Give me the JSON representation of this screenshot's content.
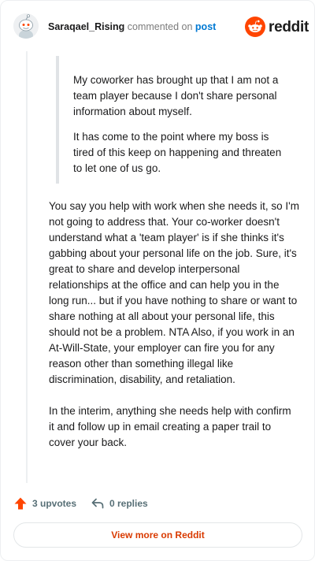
{
  "header": {
    "username": "Saraqael_Rising",
    "commented_on": "commented on",
    "post_link": "post",
    "brand": "reddit"
  },
  "quote": {
    "paragraphs": [
      "My coworker has brought up that I am not a team player because I don't share personal information about myself.",
      "It has come to the point where my boss is tired of this keep on happening and threaten to let one of us go."
    ]
  },
  "comment": {
    "paragraphs": [
      "You say you help with work when she needs it, so I'm not going to address that. Your co-worker doesn't understand what a 'team player' is if she thinks it's gabbing about your personal life on the job. Sure, it's great to share and develop interpersonal relationships at the office and can help you in the long run... but if you have nothing to share or want to share nothing at all about your personal life, this should not be a problem. NTA Also, if you work in an At-Will-State, your employer can fire you for any reason other than something illegal like discrimination, disability, and retaliation.",
      "In the interim, anything she needs help with confirm it and follow up in email creating a paper trail to cover your back."
    ]
  },
  "actions": {
    "upvotes": "3 upvotes",
    "replies": "0 replies"
  },
  "footer": {
    "view_more": "View more on Reddit"
  },
  "colors": {
    "brand_orange": "#ff4500",
    "link_blue": "#0079d3",
    "view_more_text": "#d93a00",
    "meta_gray": "#576f76"
  },
  "icons": {
    "avatar": "snoo-avatar",
    "brand": "reddit-logo-icon",
    "upvote": "upvote-arrow-icon",
    "reply": "reply-arrow-icon"
  }
}
